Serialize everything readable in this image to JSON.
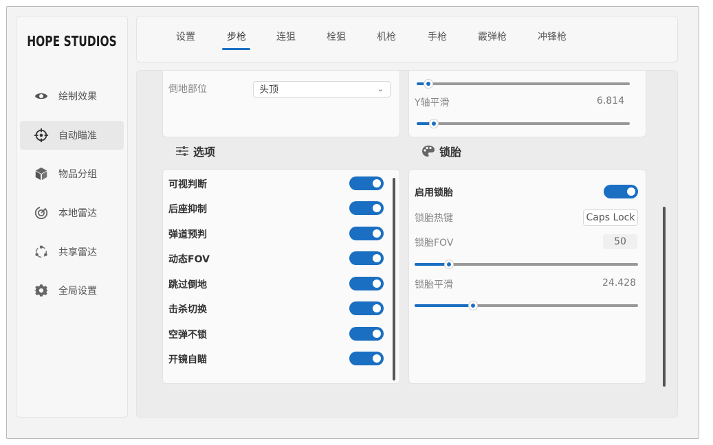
{
  "brand": "HOPE STUDIOS",
  "sidebar": {
    "items": [
      {
        "label": "绘制效果",
        "icon": "eye-icon",
        "active": false
      },
      {
        "label": "自动瞄准",
        "icon": "crosshair-icon",
        "active": true
      },
      {
        "label": "物品分组",
        "icon": "box-icon",
        "active": false
      },
      {
        "label": "本地雷达",
        "icon": "radar-icon",
        "active": false
      },
      {
        "label": "共享雷达",
        "icon": "share-icon",
        "active": false
      },
      {
        "label": "全局设置",
        "icon": "gear-icon",
        "active": false
      }
    ]
  },
  "tabs": [
    {
      "label": "设置"
    },
    {
      "label": "步枪",
      "active": true
    },
    {
      "label": "连狙"
    },
    {
      "label": "栓狙"
    },
    {
      "label": "机枪"
    },
    {
      "label": "手枪"
    },
    {
      "label": "霰弹枪"
    },
    {
      "label": "冲锋枪"
    }
  ],
  "top_left": {
    "fallen_part_label": "倒地部位",
    "fallen_part_value": "头顶"
  },
  "top_right": {
    "y_smooth_label": "Y轴平滑",
    "y_smooth_value": "6.814",
    "y_smooth_level": 0.09
  },
  "options": {
    "title": "选项",
    "items": [
      {
        "label": "可视判断",
        "on": true
      },
      {
        "label": "后座抑制",
        "on": true
      },
      {
        "label": "弹道预判",
        "on": true
      },
      {
        "label": "动态FOV",
        "on": true
      },
      {
        "label": "跳过倒地",
        "on": true
      },
      {
        "label": "击杀切换",
        "on": true
      },
      {
        "label": "空弹不锁",
        "on": true
      },
      {
        "label": "开镜自瞄",
        "on": true
      }
    ]
  },
  "lock_tire": {
    "title": "锁胎",
    "enable_label": "启用锁胎",
    "enable_on": true,
    "hotkey_label": "锁胎热键",
    "hotkey_value": "Caps Lock",
    "fov_label": "锁胎FOV",
    "fov_value": "50",
    "fov_level": 0.15,
    "smooth_label": "锁胎平滑",
    "smooth_value": "24.428",
    "smooth_level": 0.26
  },
  "colors": {
    "accent": "#1a6fc2"
  }
}
